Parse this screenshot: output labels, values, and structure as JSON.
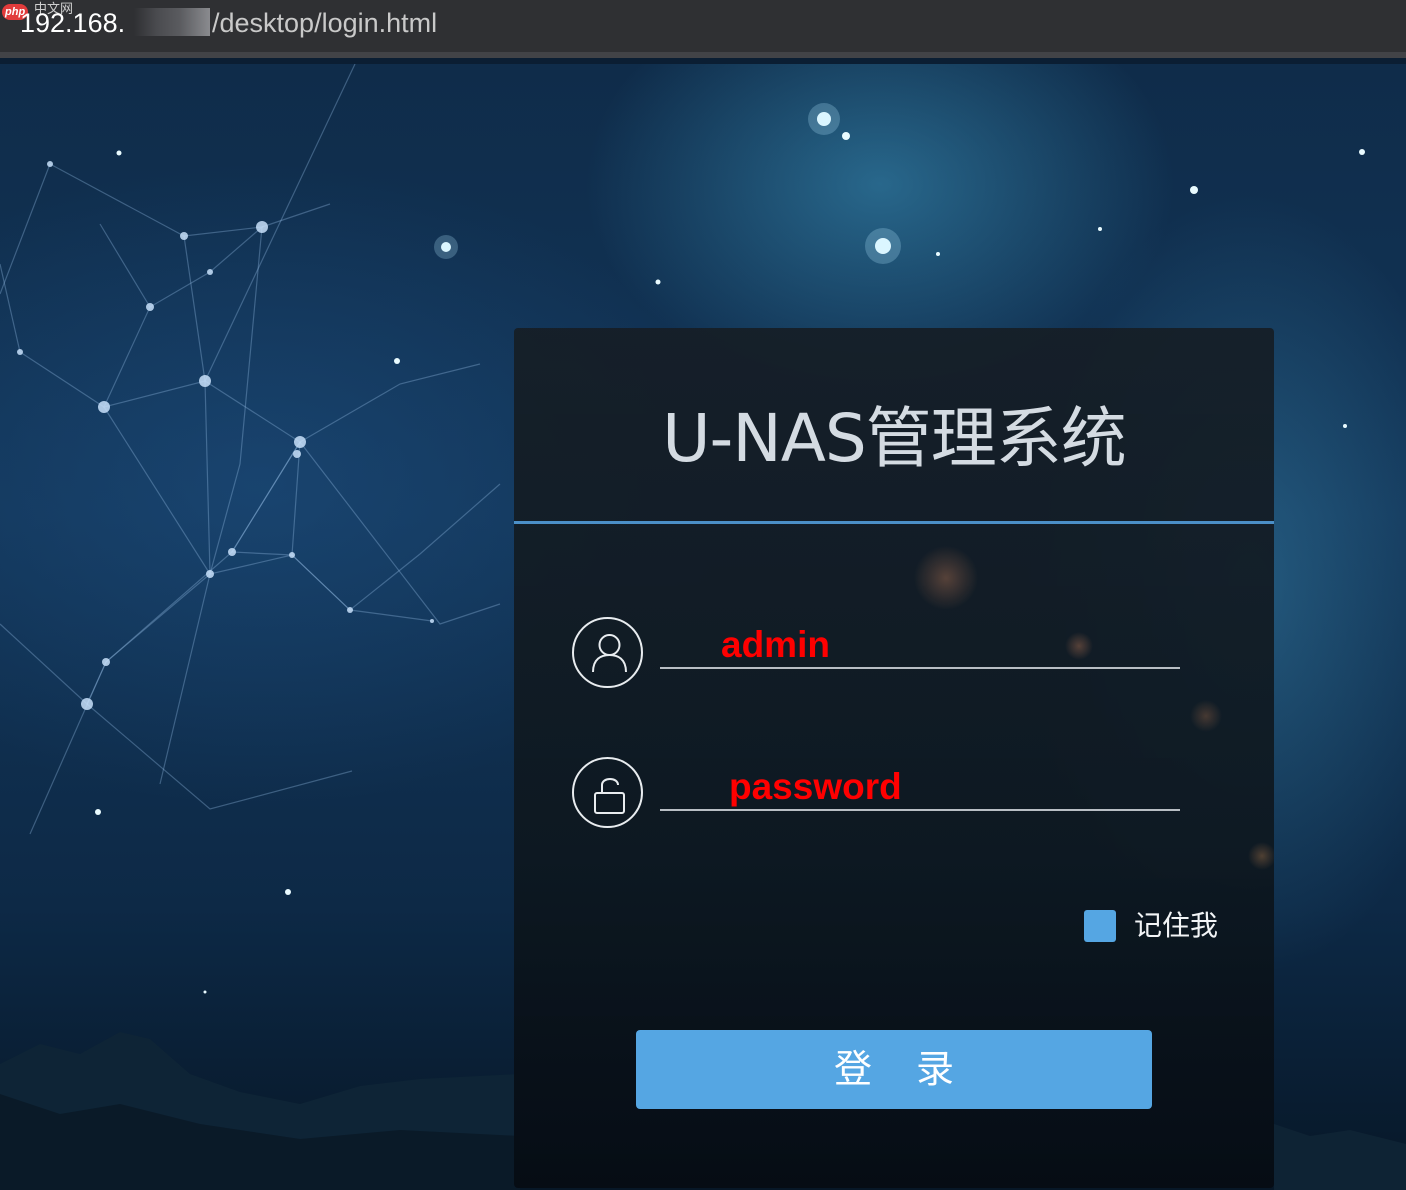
{
  "browser": {
    "badge": "php",
    "badge_site": "中文网",
    "url_host": "192.168.",
    "url_path": "/desktop/login.html"
  },
  "login": {
    "title": "U-NAS管理系统",
    "username_value": "admin",
    "password_value": "password",
    "remember_label": "记住我",
    "remember_checked": true,
    "submit_label": "登 录"
  },
  "icons": {
    "user": "user-icon",
    "lock": "unlock-icon"
  },
  "colors": {
    "accent": "#55a6e3",
    "divider": "#4b8fc7",
    "field_text": "#ff0000"
  }
}
